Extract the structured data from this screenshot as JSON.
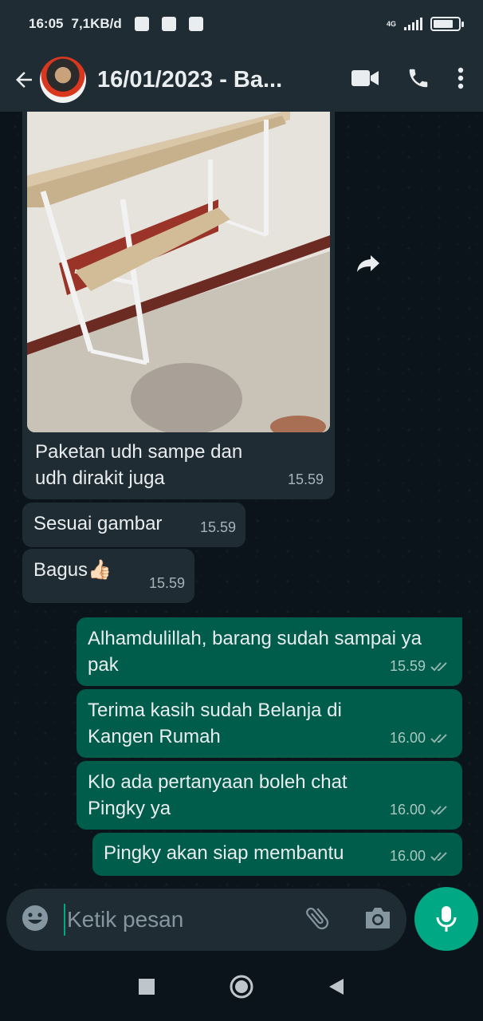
{
  "status_bar": {
    "time": "16:05",
    "data_speed": "7,1KB/d",
    "network": "4G",
    "battery_level": 0.8
  },
  "header": {
    "back_icon": "arrow-left-icon",
    "title": "16/01/2023 - Ba...",
    "video_icon": "video-camera-icon",
    "call_icon": "phone-icon",
    "menu_icon": "more-vertical-icon"
  },
  "messages": [
    {
      "direction": "in",
      "type": "image",
      "text": "Paketan udh sampe dan udh dirakit juga",
      "time": "15.59"
    },
    {
      "direction": "in",
      "text": "Sesuai gambar",
      "time": "15.59"
    },
    {
      "direction": "in",
      "text": "Bagus👍🏻",
      "time": "15.59"
    },
    {
      "direction": "out",
      "text": "Alhamdulillah, barang sudah sampai ya pak",
      "time": "15.59",
      "read": true
    },
    {
      "direction": "out",
      "text": "Terima kasih sudah Belanja di Kangen Rumah",
      "time": "16.00",
      "read": true
    },
    {
      "direction": "out",
      "text": "Klo ada pertanyaan boleh chat Pingky ya",
      "time": "16.00",
      "read": true
    },
    {
      "direction": "out",
      "text": "Pingky akan siap membantu",
      "time": "16.00",
      "read": true
    }
  ],
  "composer": {
    "placeholder": "Ketik pesan",
    "emoji_icon": "emoji-icon",
    "attach_icon": "paperclip-icon",
    "camera_icon": "camera-icon",
    "mic_icon": "microphone-icon"
  },
  "colors": {
    "background": "#0b141a",
    "header": "#1f2c34",
    "incoming_bubble": "#1f2c34",
    "outgoing_bubble": "#005c4b",
    "accent": "#00a884"
  }
}
